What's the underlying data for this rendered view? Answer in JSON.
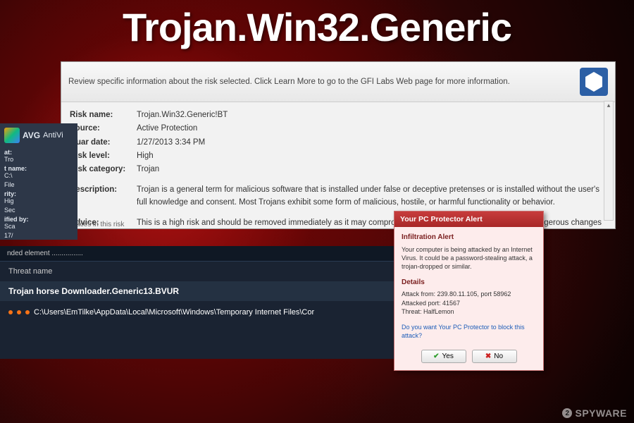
{
  "title": "Trojan.Win32.Generic",
  "gfi": {
    "header_text": "Review specific information about the risk selected. Click Learn More to go to the GFI Labs Web page for more information.",
    "rows": {
      "risk_name_label": "Risk name:",
      "risk_name": "Trojan.Win32.Generic!BT",
      "source_label": "Source:",
      "source": "Active Protection",
      "quar_date_label": "Quar date:",
      "quar_date": "1/27/2013 3:34 PM",
      "risk_level_label": "Risk level:",
      "risk_level": "High",
      "risk_category_label": "Risk category:",
      "risk_category": "Trojan",
      "description_label": "Description:",
      "description": "Trojan is a general term for malicious software that is installed under false or deceptive pretenses or is installed without the user's full knowledge and consent. Most Trojans exhibit some form of malicious, hostile, or harmful functionality or behavior.",
      "advice_label": "Advice:",
      "advice": "This is a high risk and should be removed immediately as it may compromise your privacy and security, make dangerous changes to your computer's settings without your knowledge and consent, or severely degrade"
    },
    "footer": "Traces in this risk"
  },
  "avg": {
    "brand": "AVG",
    "product": "AntiVi",
    "labels": {
      "at": "at:",
      "t_name": "t name:",
      "rity": "rity:",
      "ified_by": "ified by:"
    },
    "values": {
      "tro": "Tro",
      "path": "C:\\",
      "file": "File",
      "hig": "Hig",
      "sec": "Sec",
      "sca": "Sca",
      "date": "17/"
    },
    "ended": "nded element ................"
  },
  "threat": {
    "header": "Threat name",
    "name": "Trojan horse Downloader.Generic13.BVUR",
    "path": "C:\\Users\\EmTilke\\AppData\\Local\\Microsoft\\Windows\\Temporary Internet Files\\Cor"
  },
  "alert": {
    "title": "Your PC Protector Alert",
    "sub1": "Infiltration Alert",
    "body1": "Your computer is being attacked by an Internet Virus. It could be a password-stealing attack, a trojan-dropped or similar.",
    "sub2": "Details",
    "detail1": "Attack from: 239.80.11.105, port 58962",
    "detail2": "Attacked port: 41567",
    "detail3": "Threat: HalfLemon",
    "link": "Do you want Your PC Protector to block this attack?",
    "yes": "Yes",
    "no": "No"
  },
  "watermark": {
    "num": "2",
    "text": "SPYWARE"
  }
}
